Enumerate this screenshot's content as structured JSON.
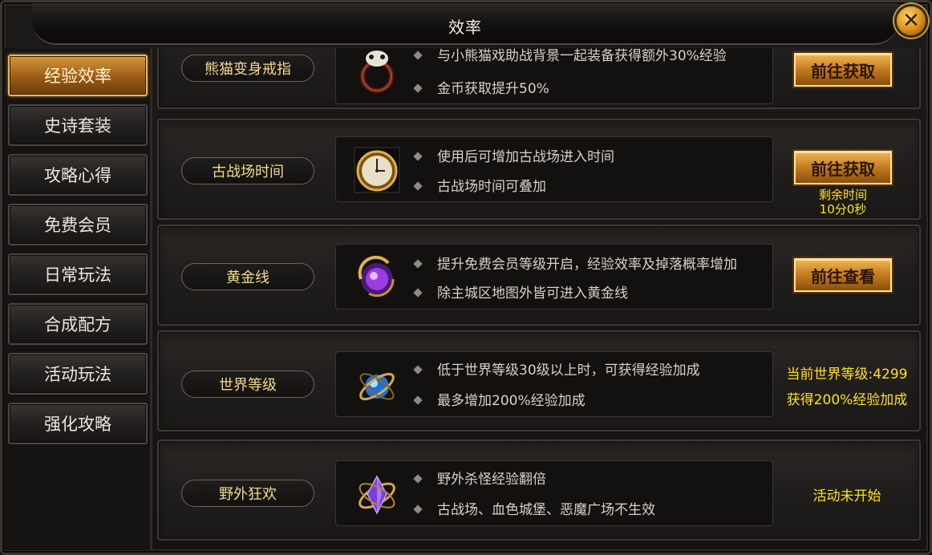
{
  "window": {
    "title": "效率"
  },
  "sidebar": {
    "items": [
      {
        "label": "经验效率",
        "active": true
      },
      {
        "label": "史诗套装",
        "active": false
      },
      {
        "label": "攻略心得",
        "active": false
      },
      {
        "label": "免费会员",
        "active": false
      },
      {
        "label": "日常玩法",
        "active": false
      },
      {
        "label": "合成配方",
        "active": false
      },
      {
        "label": "活动玩法",
        "active": false
      },
      {
        "label": "强化攻略",
        "active": false
      }
    ]
  },
  "rows": [
    {
      "label": "熊猫变身戒指",
      "icon": "panda-ring-icon",
      "lines": [
        "与小熊猫戏助战背景一起装备获得额外30%经验",
        "金币获取提升50%"
      ],
      "button": "前往获取"
    },
    {
      "label": "古战场时间",
      "icon": "pocket-watch-icon",
      "lines": [
        "使用后可增加古战场进入时间",
        "古战场时间可叠加"
      ],
      "button": "前往获取",
      "timer_label": "剩余时间",
      "timer_value": "10分0秒"
    },
    {
      "label": "黄金线",
      "icon": "purple-orb-icon",
      "lines": [
        "提升免费会员等级开启，经验效率及掉落概率增加",
        "除主城区地图外皆可进入黄金线"
      ],
      "button": "前往查看"
    },
    {
      "label": "世界等级",
      "icon": "blue-orb-icon",
      "lines": [
        "低于世界等级30级以上时，可获得经验加成",
        "最多增加200%经验加成"
      ],
      "status_line1": "当前世界等级:4299",
      "status_line2": "获得200%经验加成"
    },
    {
      "label": "野外狂欢",
      "icon": "purple-crystal-icon",
      "lines": [
        "野外杀怪经验翻倍",
        "古战场、血色城堡、恶魔广场不生效"
      ],
      "status_line1": "活动未开始"
    }
  ],
  "colors": {
    "accent_gold": "#c37a1e",
    "highlight_yellow": "#ffe21a",
    "label_gold": "#f3d98a"
  }
}
